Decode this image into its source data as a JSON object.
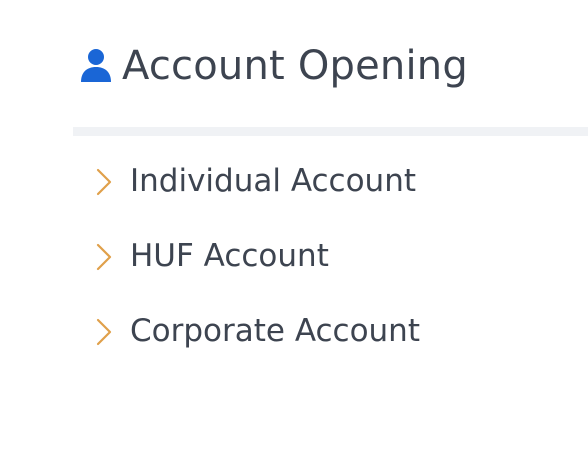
{
  "section": {
    "title": "Account Opening",
    "icon": "user-icon"
  },
  "menu": {
    "items": [
      {
        "label": "Individual Account",
        "icon": "chevron-right-icon"
      },
      {
        "label": "HUF Account",
        "icon": "chevron-right-icon"
      },
      {
        "label": "Corporate Account",
        "icon": "chevron-right-icon"
      }
    ]
  },
  "colors": {
    "text": "#3d4450",
    "icon_blue": "#1a66d6",
    "chevron_orange": "#e0a04a",
    "divider": "#f0f2f5"
  }
}
